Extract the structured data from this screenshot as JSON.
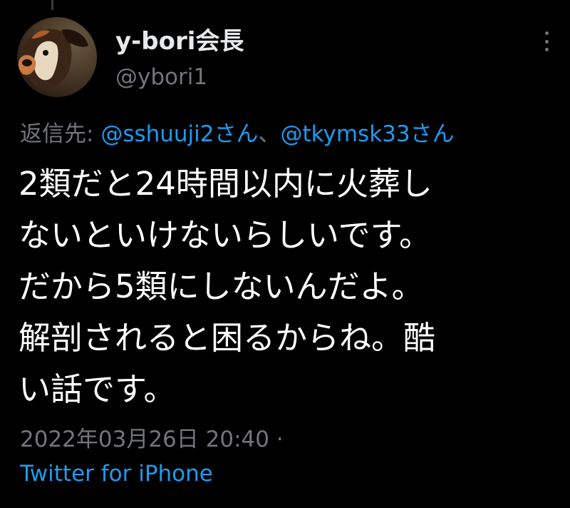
{
  "tweet": {
    "author": {
      "display_name": "y-bori会長",
      "handle": "@ybori1",
      "avatar_icon": "dog-avatar-icon"
    },
    "reply": {
      "prefix": "返信先: ",
      "mentions": [
        "@sshuuji2さん",
        "@tkymsk33さん"
      ],
      "separator": "、"
    },
    "text_lines": [
      "2類だと24時間以内に火葬し",
      "ないといけないらしいです。",
      "だから5類にしないんだよ。",
      "解剖されると困るからね。酷",
      "い話です。"
    ],
    "timestamp": "2022年03月26日 20:40 ·",
    "source": "Twitter for iPhone",
    "more_icon": "more-vertical-icon"
  },
  "colors": {
    "background": "#000000",
    "primary_text": "#ffffff",
    "secondary_text": "#71767b",
    "link": "#1d9bf0"
  }
}
